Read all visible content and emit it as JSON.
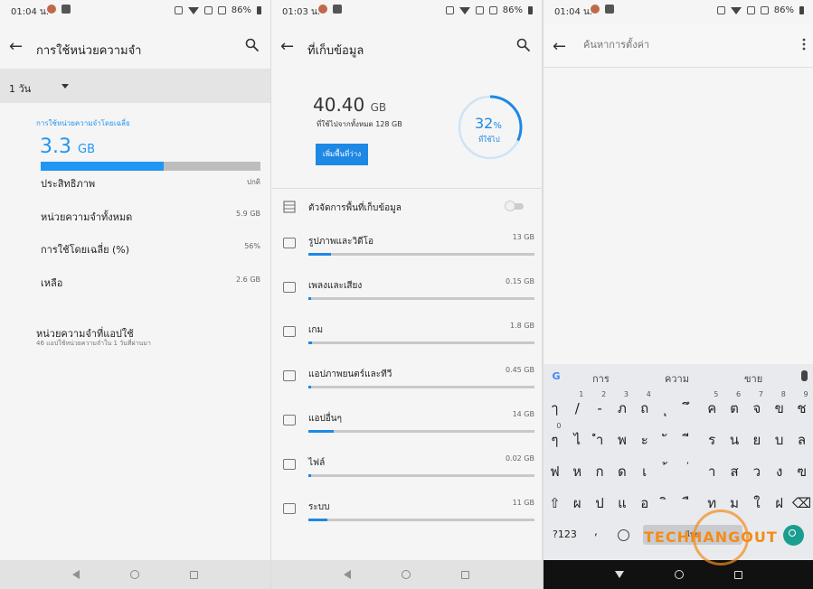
{
  "status_bars": [
    {
      "time": "01:04 น.",
      "battery": "86%"
    },
    {
      "time": "01:03 น.",
      "battery": "86%"
    },
    {
      "time": "01:04 น.",
      "battery": "86%"
    }
  ],
  "panel_memory": {
    "title": "การใช้หน่วยความจำ",
    "period": "1 วัน",
    "avg_label": "การใช้หน่วยความจำโดยเฉลี่ย",
    "avg_value": "3.3",
    "avg_unit": "GB",
    "usage_fraction": 0.56,
    "rows": [
      {
        "label": "ประสิทธิภาพ",
        "value": "ปกติ"
      },
      {
        "label": "หน่วยความจำทั้งหมด",
        "value": "5.9 GB"
      },
      {
        "label": "การใช้โดยเฉลี่ย (%)",
        "value": "56%"
      },
      {
        "label": "เหลือ",
        "value": "2.6 GB"
      }
    ],
    "apps_title": "หน่วยความจำที่แอปใช้",
    "apps_sub": "46 แอปใช้หน่วยความจำใน 1 วันที่ผ่านมา"
  },
  "panel_storage": {
    "title": "ที่เก็บข้อมูล",
    "used_value": "40.40",
    "used_unit": "GB",
    "used_of": "ที่ใช้ไปจากทั้งหมด 128 GB",
    "free_button": "เพิ่มพื้นที่ว่าง",
    "percent_value": "32",
    "percent_sign": "%",
    "percent_label": "ที่ใช้ไป",
    "percent_fraction": 0.32,
    "manager_label": "ตัวจัดการพื้นที่เก็บข้อมูล",
    "manager_on": false,
    "categories": [
      {
        "name": "รูปภาพและวิดีโอ",
        "size": "13 GB",
        "icon": "image-icon",
        "fraction": 0.1
      },
      {
        "name": "เพลงและเสียง",
        "size": "0.15 GB",
        "icon": "music-note-icon",
        "fraction": 0.005
      },
      {
        "name": "เกม",
        "size": "1.8 GB",
        "icon": "gamepad-icon",
        "fraction": 0.015
      },
      {
        "name": "แอปภาพยนตร์และทีวี",
        "size": "0.45 GB",
        "icon": "video-camera-icon",
        "fraction": 0.004
      },
      {
        "name": "แอปอื่นๆ",
        "size": "14 GB",
        "icon": "apps-grid-icon",
        "fraction": 0.11
      },
      {
        "name": "ไฟล์",
        "size": "0.02 GB",
        "icon": "folder-icon",
        "fraction": 0.002
      },
      {
        "name": "ระบบ",
        "size": "11 GB",
        "icon": "phone-system-icon",
        "fraction": 0.085
      }
    ]
  },
  "panel_search": {
    "placeholder": "ค้นหาการตั้งค่า",
    "suggestions": [
      "การ",
      "ความ",
      "ขาย"
    ],
    "rows": [
      {
        "keys": [
          {
            "c": "ๅ",
            "s": ""
          },
          {
            "c": "/",
            "s": "1"
          },
          {
            "c": "-",
            "s": "2"
          },
          {
            "c": "ภ",
            "s": "3"
          },
          {
            "c": "ถ",
            "s": "4"
          },
          {
            "c": "ุ",
            "s": ""
          },
          {
            "c": "ึ",
            "s": ""
          },
          {
            "c": "ค",
            "s": "5"
          },
          {
            "c": "ต",
            "s": "6"
          },
          {
            "c": "จ",
            "s": "7"
          },
          {
            "c": "ข",
            "s": "8"
          },
          {
            "c": "ช",
            "s": "9"
          }
        ]
      },
      {
        "keys": [
          {
            "c": "ๆ",
            "s": "0"
          },
          {
            "c": "ไ",
            "s": ""
          },
          {
            "c": "ำ",
            "s": ""
          },
          {
            "c": "พ",
            "s": ""
          },
          {
            "c": "ะ",
            "s": ""
          },
          {
            "c": "ั",
            "s": ""
          },
          {
            "c": "ี",
            "s": ""
          },
          {
            "c": "ร",
            "s": ""
          },
          {
            "c": "น",
            "s": ""
          },
          {
            "c": "ย",
            "s": ""
          },
          {
            "c": "บ",
            "s": ""
          },
          {
            "c": "ล",
            "s": ""
          }
        ]
      },
      {
        "keys": [
          {
            "c": "ฟ",
            "s": ""
          },
          {
            "c": "ห",
            "s": ""
          },
          {
            "c": "ก",
            "s": ""
          },
          {
            "c": "ด",
            "s": ""
          },
          {
            "c": "เ",
            "s": ""
          },
          {
            "c": "้",
            "s": ""
          },
          {
            "c": "่",
            "s": ""
          },
          {
            "c": "า",
            "s": ""
          },
          {
            "c": "ส",
            "s": ""
          },
          {
            "c": "ว",
            "s": ""
          },
          {
            "c": "ง",
            "s": ""
          },
          {
            "c": "ฃ",
            "s": ""
          }
        ]
      },
      {
        "keys": [
          {
            "c": "⇧",
            "s": ""
          },
          {
            "c": "ผ",
            "s": ""
          },
          {
            "c": "ป",
            "s": ""
          },
          {
            "c": "แ",
            "s": ""
          },
          {
            "c": "อ",
            "s": ""
          },
          {
            "c": "ิ",
            "s": ""
          },
          {
            "c": "ื",
            "s": ""
          },
          {
            "c": "ท",
            "s": ""
          },
          {
            "c": "ม",
            "s": ""
          },
          {
            "c": "ใ",
            "s": ""
          },
          {
            "c": "ฝ",
            "s": ""
          },
          {
            "c": "⌫",
            "s": ""
          }
        ]
      }
    ],
    "key_123": "?123",
    "space_label": "ไทย",
    "comma_key": ","
  },
  "watermark": "TECHHANGOUT",
  "colors": {
    "accent": "#2196f3",
    "enter_key": "#1a9e8f",
    "watermark": "#f28c1a"
  }
}
